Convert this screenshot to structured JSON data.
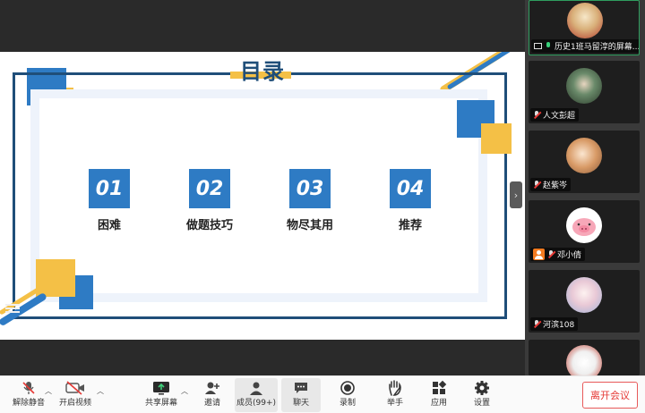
{
  "slide": {
    "title": "目录",
    "items": [
      {
        "num": "01",
        "label": "困难"
      },
      {
        "num": "02",
        "label": "做题技巧"
      },
      {
        "num": "03",
        "label": "物尽其用"
      },
      {
        "num": "04",
        "label": "推荐"
      }
    ],
    "colors": {
      "blue": "#2e7bc4",
      "navy": "#1f4e79",
      "yellow": "#f4c046"
    }
  },
  "participants": [
    {
      "name": "历史1班马留淳的屏幕...",
      "status": "sharing-screen",
      "avatar": "new-year-avatar"
    },
    {
      "name": "人文彭超",
      "status": "muted",
      "avatar": "photo-avatar"
    },
    {
      "name": "赵紫岑",
      "status": "muted",
      "avatar": "dog-avatar"
    },
    {
      "name": "邓小倩",
      "status": "muted",
      "avatar": "pig-avatar"
    },
    {
      "name": "河滨108",
      "status": "muted",
      "avatar": "cartoon-avatar"
    }
  ],
  "toolbar": {
    "unmute": "解除静音",
    "start_video": "开启视频",
    "share_screen": "共享屏幕",
    "invite": "邀请",
    "members": "成员(99+)",
    "chat": "聊天",
    "record": "录制",
    "raise_hand": "举手",
    "apps": "应用",
    "settings": "设置",
    "leave": "离开会议"
  }
}
